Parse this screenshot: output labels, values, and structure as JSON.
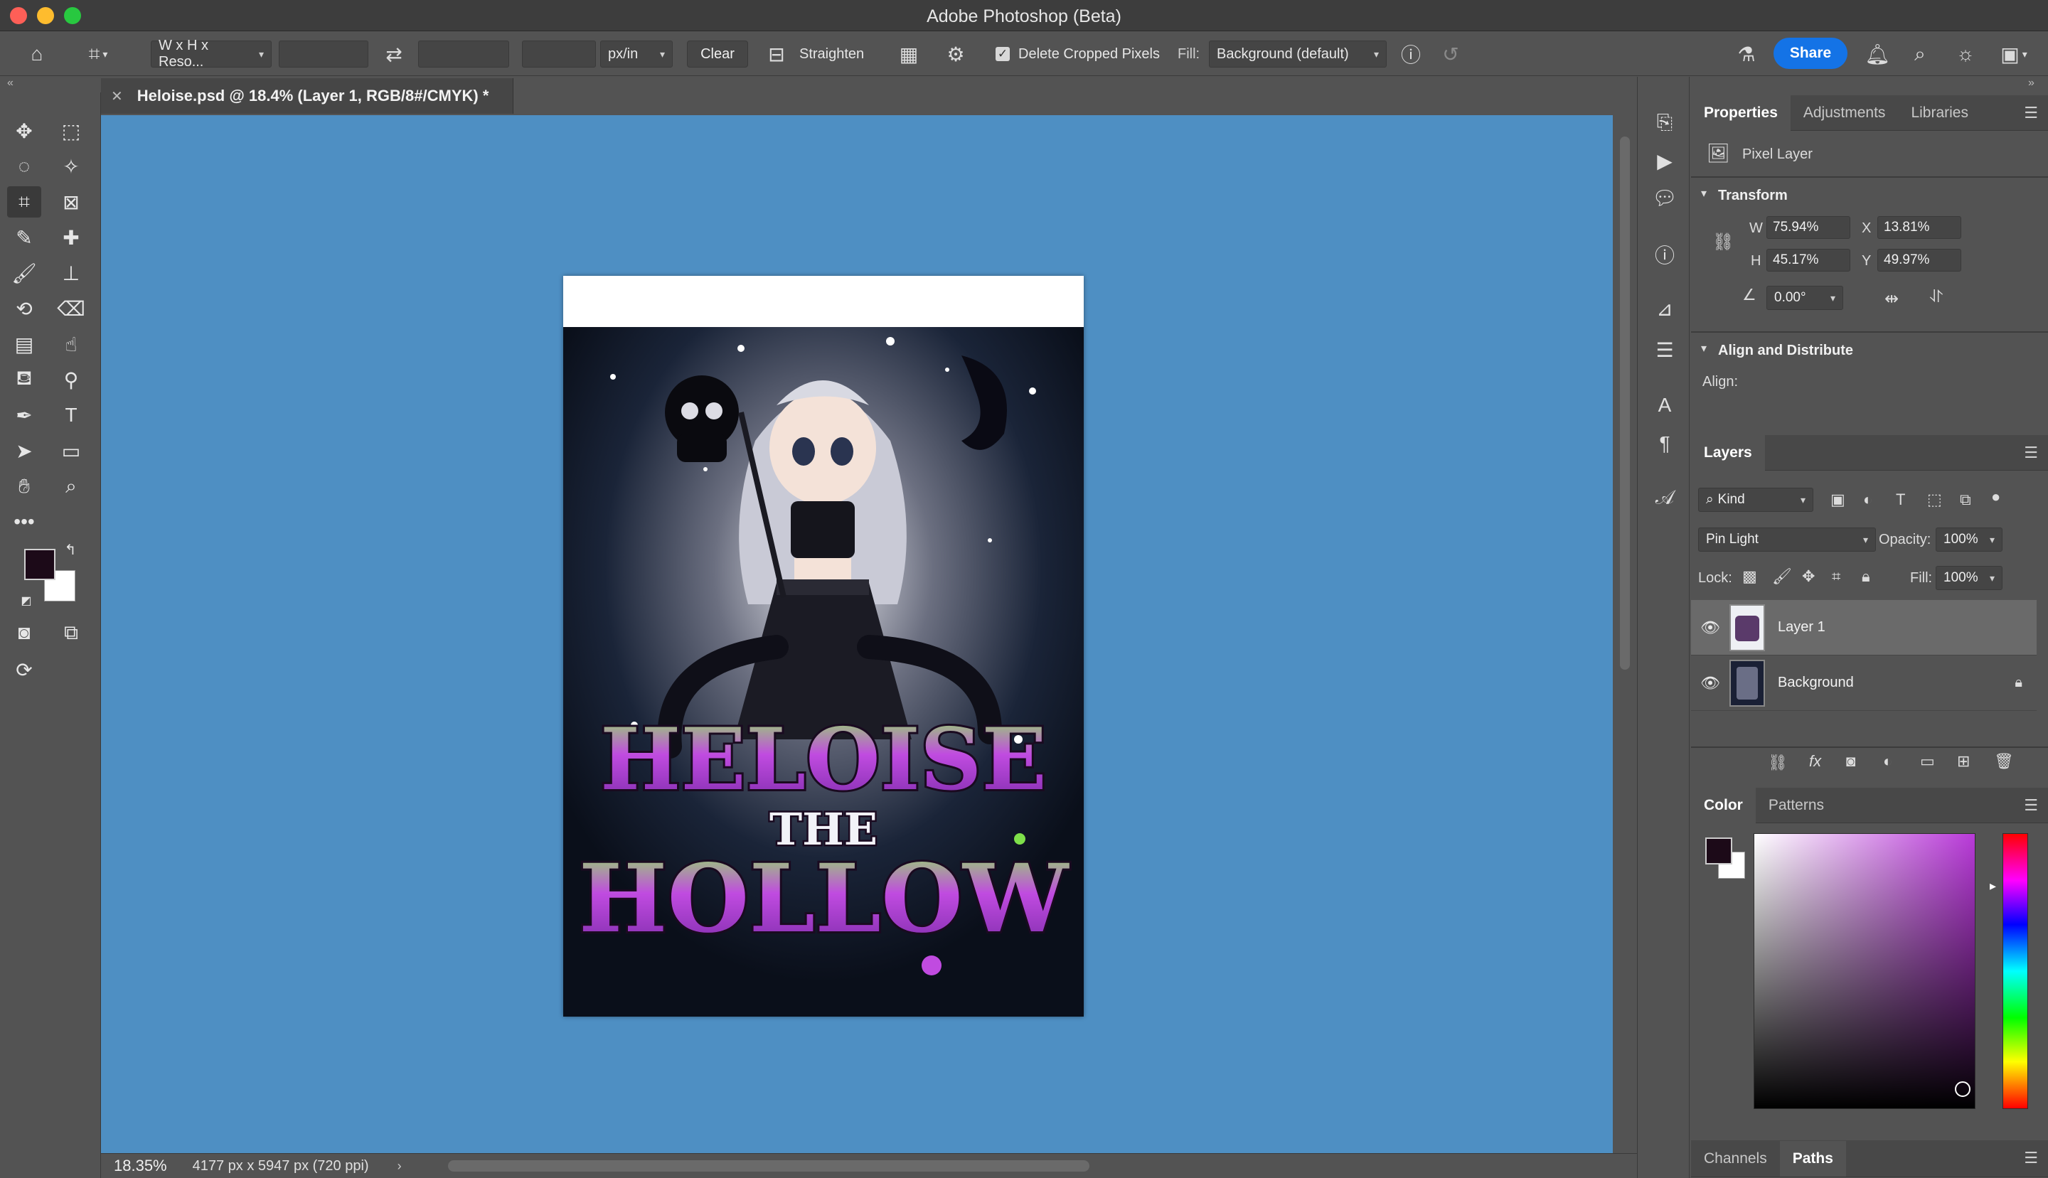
{
  "window": {
    "title": "Adobe Photoshop (Beta)"
  },
  "options_bar": {
    "ratio_preset": "W x H x Reso...",
    "width_value": "",
    "height_value": "",
    "resolution_value": "",
    "unit": "px/in",
    "clear_label": "Clear",
    "straighten_label": "Straighten",
    "delete_cropped_label": "Delete Cropped Pixels",
    "delete_cropped_checked": true,
    "fill_label": "Fill:",
    "fill_value": "Background (default)",
    "share_label": "Share"
  },
  "document": {
    "tab_title": "Heloise.psd @ 18.4% (Layer 1, RGB/8#/CMYK) *",
    "artwork": {
      "title_line1": "HELOISE",
      "title_line2": "THE",
      "title_line3": "HOLLOW"
    }
  },
  "status_bar": {
    "zoom": "18.35%",
    "doc_info": "4177 px x 5947 px (720 ppi)"
  },
  "properties_panel": {
    "tabs": [
      {
        "label": "Properties",
        "active": true
      },
      {
        "label": "Adjustments",
        "active": false
      },
      {
        "label": "Libraries",
        "active": false
      }
    ],
    "layer_type": "Pixel Layer",
    "transform": {
      "heading": "Transform",
      "w_label": "W",
      "w_value": "75.94%",
      "h_label": "H",
      "h_value": "45.17%",
      "x_label": "X",
      "x_value": "13.81%",
      "y_label": "Y",
      "y_value": "49.97%",
      "angle_value": "0.00°"
    },
    "align": {
      "heading": "Align and Distribute",
      "align_label": "Align:"
    }
  },
  "layers_panel": {
    "tab": "Layers",
    "filter_kind": "Kind",
    "blend_mode": "Pin Light",
    "opacity_label": "Opacity:",
    "opacity_value": "100%",
    "lock_label": "Lock:",
    "fill_label": "Fill:",
    "fill_value": "100%",
    "layers": [
      {
        "name": "Layer 1",
        "visible": true,
        "selected": true,
        "locked": false
      },
      {
        "name": "Background",
        "visible": true,
        "selected": false,
        "locked": true
      }
    ]
  },
  "color_panel": {
    "tabs": [
      {
        "label": "Color",
        "active": true
      },
      {
        "label": "Patterns",
        "active": false
      }
    ],
    "foreground": "#1c0a18",
    "background": "#ffffff"
  },
  "bottom_tabs": [
    {
      "label": "Channels",
      "active": false
    },
    {
      "label": "Paths",
      "active": true
    }
  ],
  "colors": {
    "canvas_bg": "#4e8fc3",
    "accent": "#1473e6",
    "artwork_green": "#7ee04a",
    "artwork_purple": "#c04be0"
  }
}
